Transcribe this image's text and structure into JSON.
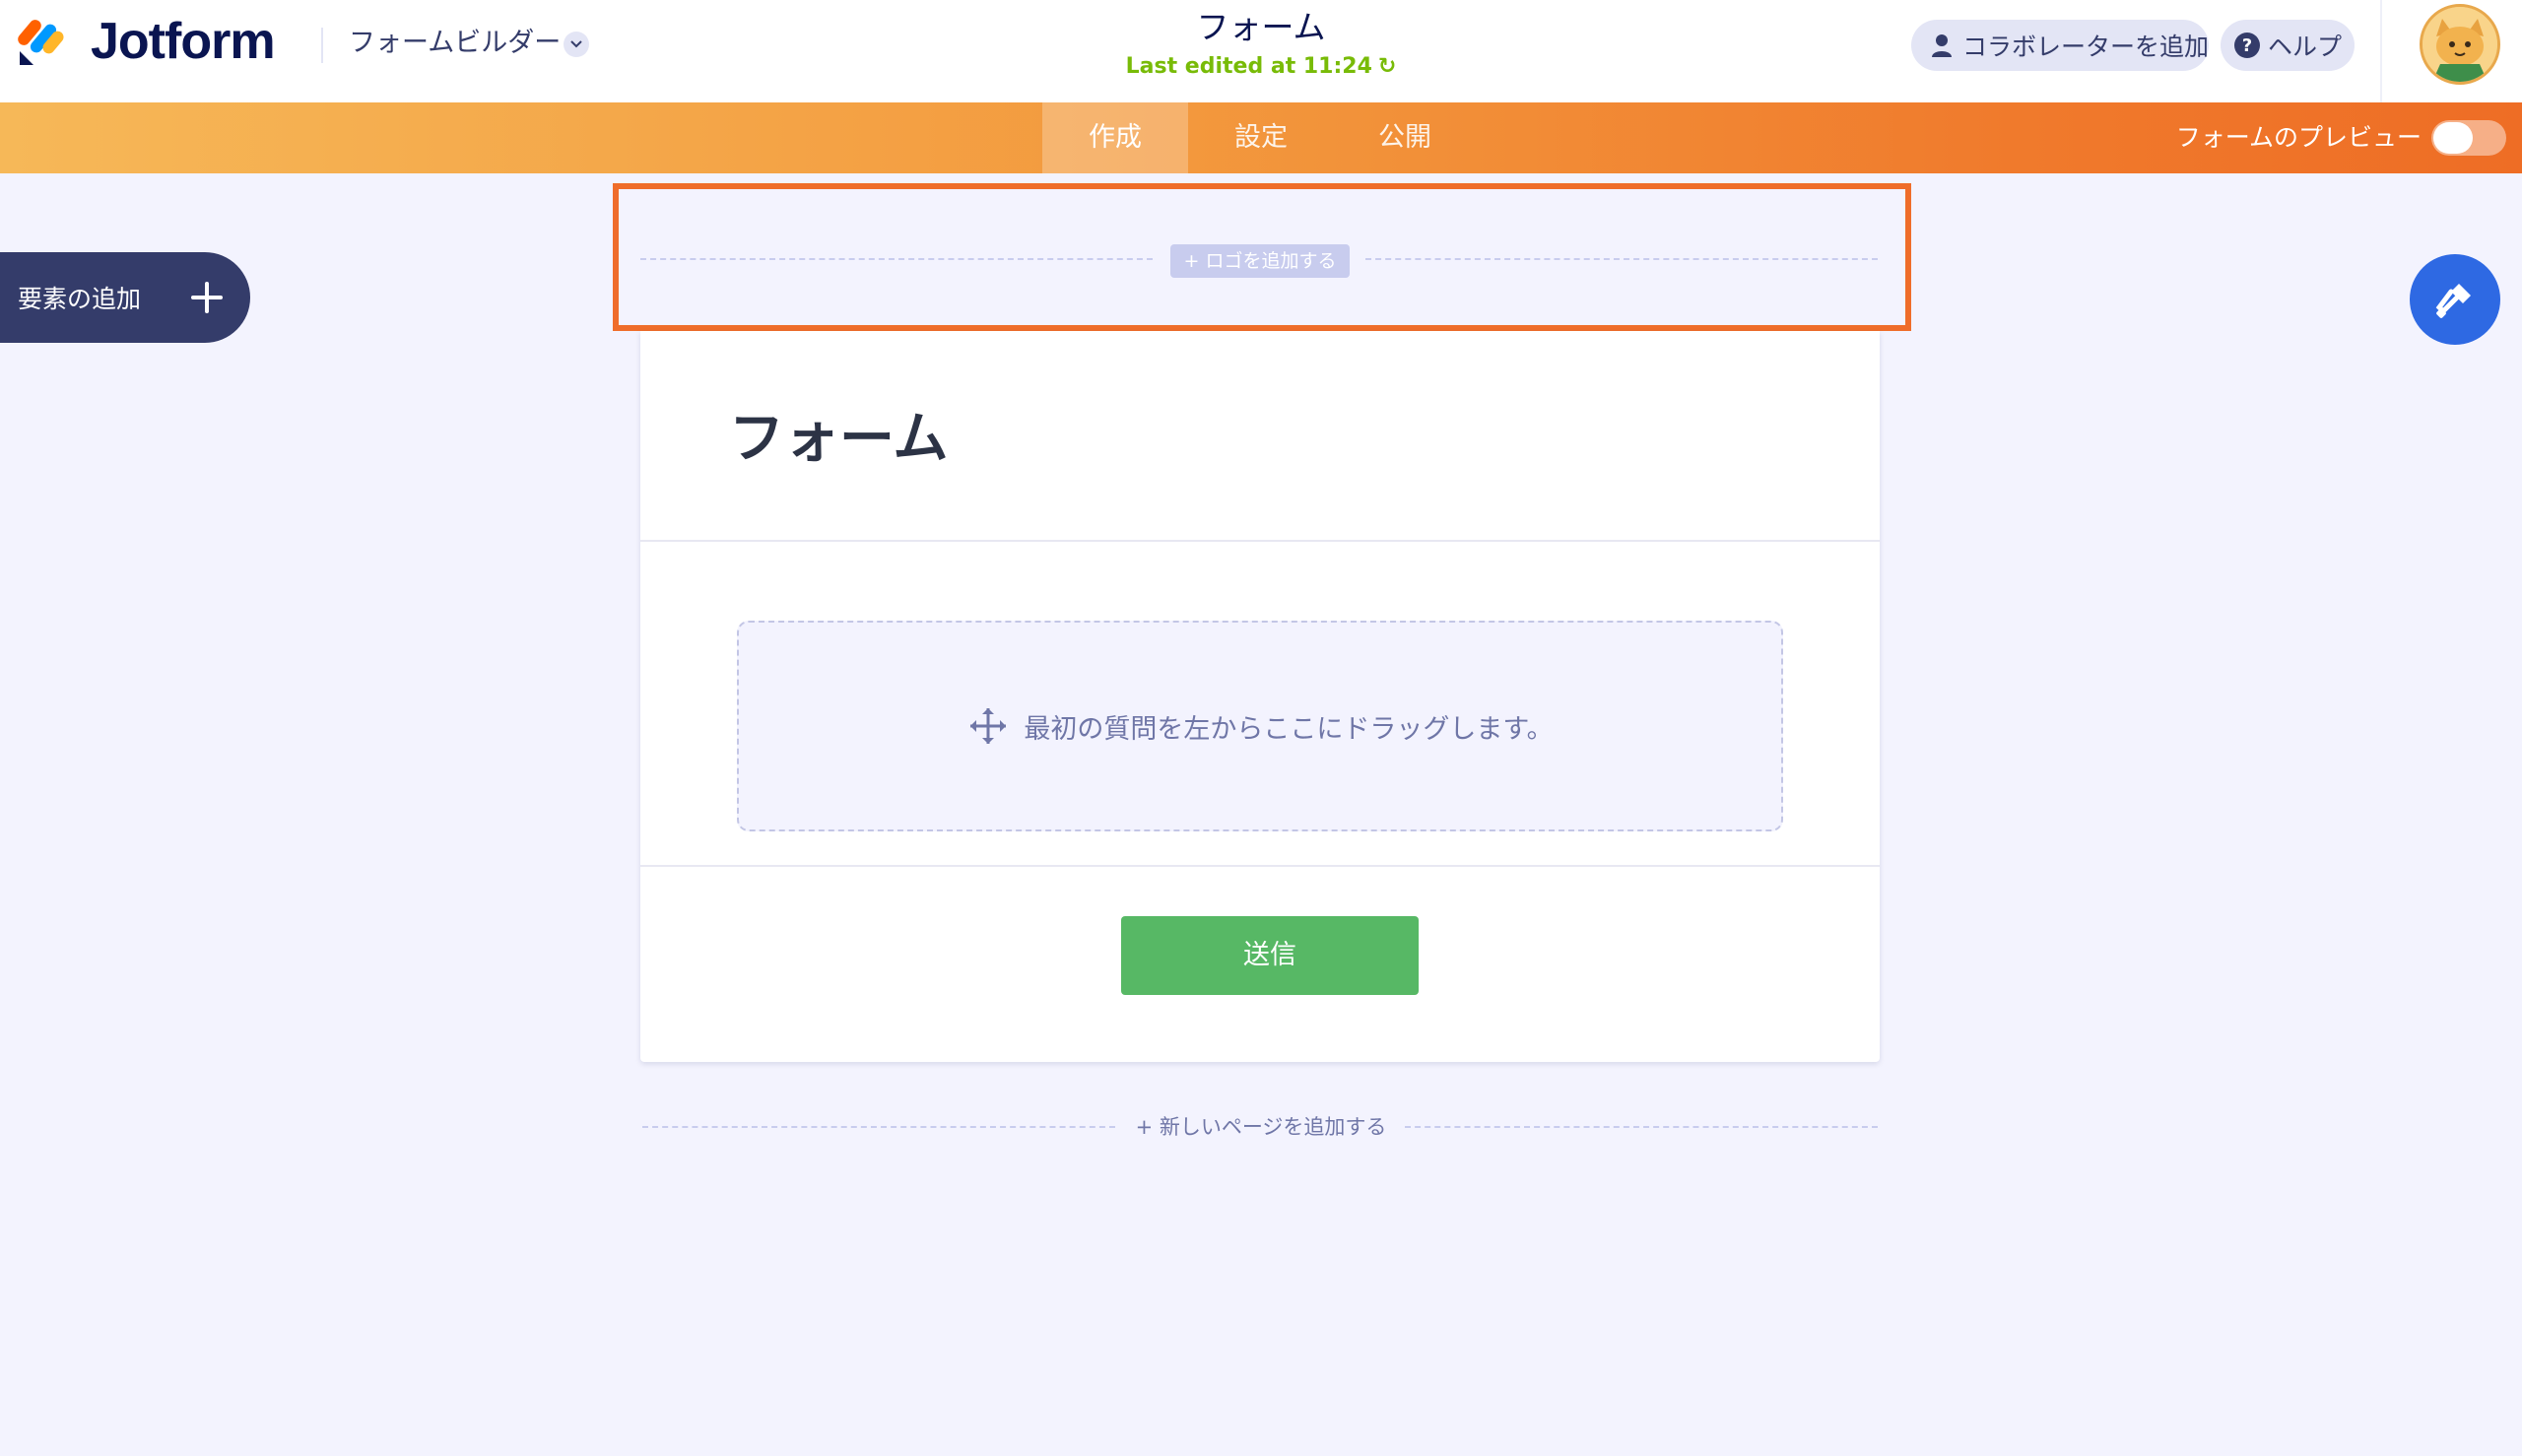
{
  "header": {
    "brand": "Jotform",
    "builder_menu": "フォームビルダー",
    "form_title": "フォーム",
    "last_edited": "Last edited at 11:24",
    "add_collaborator": "コラボレーターを追加",
    "help": "ヘルプ"
  },
  "nav": {
    "tabs": [
      {
        "label": "作成",
        "active": true
      },
      {
        "label": "設定",
        "active": false
      },
      {
        "label": "公開",
        "active": false
      }
    ],
    "preview_label": "フォームのプレビュー"
  },
  "sidebar": {
    "add_element": "要素の追加"
  },
  "logo_area": {
    "add_logo": "+ ロゴを追加する"
  },
  "form": {
    "heading": "フォーム",
    "drop_hint": "最初の質問を左からここにドラッグします。",
    "submit": "送信"
  },
  "footer": {
    "add_page": "+ 新しいページを追加する"
  },
  "colors": {
    "accent_orange": "#ef6d2a",
    "submit_green": "#57b865",
    "designer_blue": "#2e69e3",
    "dark_navy": "#343c6a",
    "edited_green": "#78bb07"
  }
}
